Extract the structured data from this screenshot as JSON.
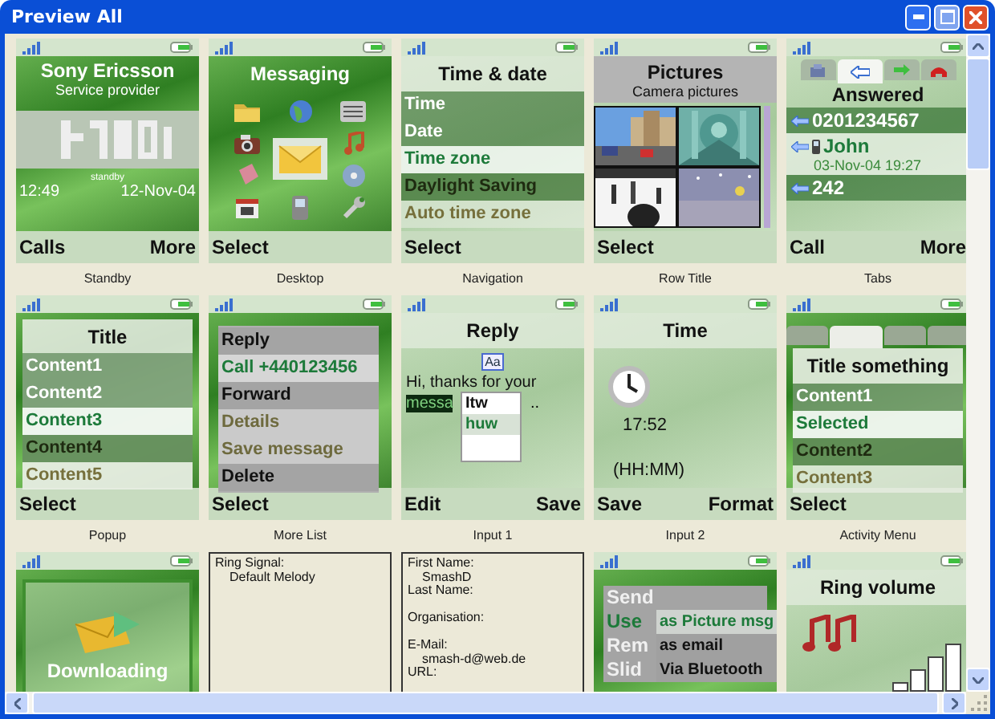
{
  "window": {
    "title": "Preview All"
  },
  "previews": [
    {
      "kind": "standby",
      "caption": "Standby",
      "operator": "Sony Ericsson",
      "provider": "Service provider",
      "mode": "standby",
      "time": "12:49",
      "date": "12-Nov-04",
      "softkeys": {
        "left": "Calls",
        "right": "More"
      }
    },
    {
      "kind": "desktop",
      "caption": "Desktop",
      "title": "Messaging",
      "softkeys": {
        "left": "Select"
      }
    },
    {
      "kind": "list",
      "caption": "Navigation",
      "title": "Time & date",
      "items": [
        {
          "label": "Time",
          "selected": false,
          "disabled": false
        },
        {
          "label": "Date",
          "selected": false,
          "disabled": false
        },
        {
          "label": "Time zone",
          "selected": true,
          "disabled": false
        },
        {
          "label": "Daylight Saving",
          "selected": false,
          "disabled": false
        },
        {
          "label": "Auto time zone",
          "selected": false,
          "disabled": true
        }
      ],
      "softkeys": {
        "left": "Select"
      }
    },
    {
      "kind": "pictures",
      "caption": "Row Title",
      "title": "Pictures",
      "subtitle": "Camera pictures",
      "softkeys": {
        "left": "Select"
      }
    },
    {
      "kind": "tabs",
      "caption": "Tabs",
      "tabs": [
        {
          "selected": false
        },
        {
          "selected": true
        },
        {
          "selected": false
        },
        {
          "selected": false
        }
      ],
      "title": "Answered",
      "entries": [
        {
          "label": "0201234567",
          "selected": false
        },
        {
          "label": "John",
          "detail": "03-Nov-04 19:27",
          "selected": true
        },
        {
          "label": "242",
          "selected": false
        }
      ],
      "softkeys": {
        "left": "Call",
        "right": "More"
      }
    },
    {
      "kind": "popup",
      "caption": "Popup",
      "title": "Title",
      "items": [
        {
          "label": "Content1",
          "selected": false,
          "disabled": false
        },
        {
          "label": "Content2",
          "selected": false,
          "disabled": false
        },
        {
          "label": "Content3",
          "selected": true,
          "disabled": false
        },
        {
          "label": "Content4",
          "selected": false,
          "disabled": false
        },
        {
          "label": "Content5",
          "selected": false,
          "disabled": true
        }
      ],
      "softkeys": {
        "left": "Select"
      }
    },
    {
      "kind": "menu",
      "caption": "More List",
      "items": [
        {
          "label": "Reply",
          "selected": false,
          "disabled": false
        },
        {
          "label": "Call +440123456",
          "selected": true,
          "disabled": false
        },
        {
          "label": "Forward",
          "selected": false,
          "disabled": false
        },
        {
          "label": "Details",
          "selected": false,
          "disabled": true
        },
        {
          "label": "Save message",
          "selected": false,
          "disabled": true
        },
        {
          "label": "Delete",
          "selected": false,
          "disabled": false
        }
      ],
      "softkeys": {
        "left": "Select"
      }
    },
    {
      "kind": "input",
      "caption": "Input 1",
      "title": "Reply",
      "mode": "Aa",
      "text": "Hi, thanks for your",
      "word": "messa",
      "rest": "..",
      "suggestions": [
        {
          "label": "Itw",
          "selected": false
        },
        {
          "label": "huw",
          "selected": true
        }
      ],
      "softkeys": {
        "left": "Edit",
        "right": "Save"
      }
    },
    {
      "kind": "clock",
      "caption": "Input 2",
      "title": "Time",
      "time": "17:52",
      "format": "(HH:MM)",
      "softkeys": {
        "left": "Save",
        "right": "Format"
      }
    },
    {
      "kind": "activity",
      "caption": "Activity Menu",
      "tabs": [
        {
          "selected": false
        },
        {
          "selected": true
        },
        {
          "selected": false
        },
        {
          "selected": false
        }
      ],
      "title": "Title something",
      "items": [
        {
          "label": "Content1",
          "selected": false,
          "disabled": false
        },
        {
          "label": "Selected",
          "selected": true,
          "disabled": false
        },
        {
          "label": "Content2",
          "selected": false,
          "disabled": false
        },
        {
          "label": "Content3",
          "selected": false,
          "disabled": true
        }
      ],
      "softkeys": {
        "left": "Select"
      }
    },
    {
      "kind": "download",
      "label": "Downloading"
    },
    {
      "kind": "details",
      "fields": [
        {
          "label": "Ring Signal:",
          "value": "Default Melody"
        }
      ]
    },
    {
      "kind": "details",
      "fields": [
        {
          "label": "First Name:",
          "value": "SmashD"
        },
        {
          "label": "Last Name:"
        },
        {
          "label": "Organisation:"
        },
        {
          "label": "E-Mail:",
          "value": "smash-d@web.de"
        },
        {
          "label": "URL:"
        }
      ]
    },
    {
      "kind": "submenu",
      "items": [
        {
          "label": "Send",
          "selected": false
        },
        {
          "label": "Use",
          "selected": true
        },
        {
          "label": "Rem",
          "selected": false
        },
        {
          "label": "Slid",
          "selected": false
        }
      ],
      "submenu": [
        {
          "label": "as Picture msg",
          "selected": true
        },
        {
          "label": "as email",
          "selected": false
        },
        {
          "label": "Via Bluetooth",
          "selected": false
        }
      ]
    },
    {
      "kind": "volume",
      "title": "Ring volume"
    }
  ]
}
